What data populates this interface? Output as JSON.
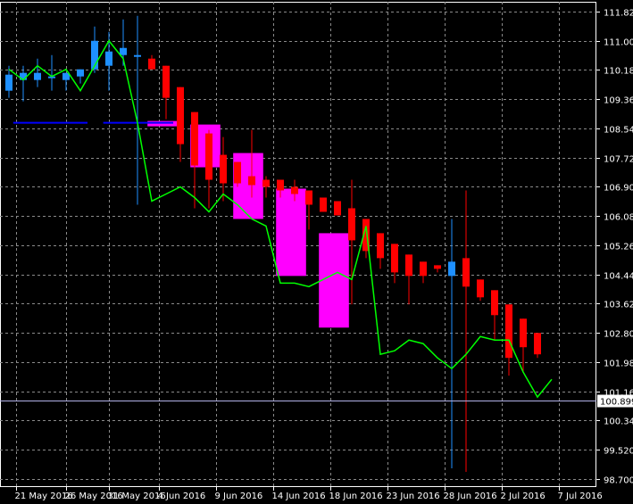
{
  "chart_data": {
    "type": "candlestick",
    "colors": {
      "background": "#000000",
      "grid": "#8a8a8a",
      "axis": "#ffffff",
      "bull": "#1e90ff",
      "bear": "#ff0000",
      "indicator_line": "#00ff00",
      "zone": "#ff00ff",
      "support": "#0000ff",
      "current_price_line": "#b0b0e6"
    },
    "y_ticks": [
      "111.820",
      "111.000",
      "110.180",
      "109.360",
      "108.540",
      "107.720",
      "106.900",
      "106.080",
      "105.260",
      "104.440",
      "103.620",
      "102.800",
      "101.980",
      "101.160",
      "100.340",
      "99.520",
      "98.700"
    ],
    "ylim": [
      98.7,
      111.82
    ],
    "x_ticks": [
      {
        "label": "21 May 2016",
        "i": 0.5
      },
      {
        "label": "26 May 2016",
        "i": 4
      },
      {
        "label": "31 May 2016",
        "i": 7
      },
      {
        "label": "4 Jun 2016",
        "i": 10.5
      },
      {
        "label": "9 Jun 2016",
        "i": 14.5
      },
      {
        "label": "14 Jun 2016",
        "i": 18.5
      },
      {
        "label": "18 Jun 2016",
        "i": 22.5
      },
      {
        "label": "23 Jun 2016",
        "i": 26.5
      },
      {
        "label": "28 Jun 2016",
        "i": 30.5
      },
      {
        "label": "2 Jul 2016",
        "i": 34.5
      },
      {
        "label": "7 Jul 2016",
        "i": 38.5
      }
    ],
    "current_price": {
      "label": "100.899",
      "value": 100.899
    },
    "candles": [
      {
        "o": 109.6,
        "h": 110.3,
        "l": 109.4,
        "c": 110.05
      },
      {
        "o": 109.9,
        "h": 110.3,
        "l": 109.3,
        "c": 110.1
      },
      {
        "o": 109.9,
        "h": 110.5,
        "l": 109.7,
        "c": 110.1
      },
      {
        "o": 110.0,
        "h": 110.6,
        "l": 109.6,
        "c": 110.0
      },
      {
        "o": 109.9,
        "h": 110.0,
        "l": 109.6,
        "c": 110.1
      },
      {
        "o": 110.0,
        "h": 110.2,
        "l": 109.8,
        "c": 110.2
      },
      {
        "o": 110.2,
        "h": 111.4,
        "l": 110.1,
        "c": 111.0
      },
      {
        "o": 110.3,
        "h": 111.25,
        "l": 109.6,
        "c": 110.7
      },
      {
        "o": 110.6,
        "h": 111.6,
        "l": 110.3,
        "c": 110.8
      },
      {
        "o": 110.55,
        "h": 111.7,
        "l": 106.4,
        "c": 110.6
      },
      {
        "o": 110.5,
        "h": 110.6,
        "l": 110.2,
        "c": 110.2
      },
      {
        "o": 110.3,
        "h": 110.3,
        "l": 108.8,
        "c": 109.4
      },
      {
        "o": 109.7,
        "h": 109.7,
        "l": 107.6,
        "c": 108.1
      },
      {
        "o": 109.0,
        "h": 109.0,
        "l": 106.3,
        "c": 107.5
      },
      {
        "o": 108.4,
        "h": 108.5,
        "l": 106.3,
        "c": 107.1
      },
      {
        "o": 107.8,
        "h": 108.3,
        "l": 106.5,
        "c": 107.0
      },
      {
        "o": 107.6,
        "h": 107.6,
        "l": 106.9,
        "c": 107.0
      },
      {
        "o": 107.2,
        "h": 108.5,
        "l": 106.6,
        "c": 106.95
      },
      {
        "o": 107.1,
        "h": 107.2,
        "l": 106.6,
        "c": 106.9
      },
      {
        "o": 107.1,
        "h": 107.1,
        "l": 106.6,
        "c": 106.8
      },
      {
        "o": 106.9,
        "h": 107.1,
        "l": 106.5,
        "c": 106.7
      },
      {
        "o": 106.8,
        "h": 106.8,
        "l": 105.7,
        "c": 106.4
      },
      {
        "o": 106.6,
        "h": 106.6,
        "l": 106.2,
        "c": 106.2
      },
      {
        "o": 106.5,
        "h": 106.5,
        "l": 106.1,
        "c": 106.1
      },
      {
        "o": 106.3,
        "h": 107.1,
        "l": 103.6,
        "c": 105.4
      },
      {
        "o": 106.0,
        "h": 106.0,
        "l": 104.9,
        "c": 105.1
      },
      {
        "o": 105.6,
        "h": 105.6,
        "l": 104.6,
        "c": 104.9
      },
      {
        "o": 105.3,
        "h": 105.3,
        "l": 104.2,
        "c": 104.5
      },
      {
        "o": 105.0,
        "h": 105.0,
        "l": 103.6,
        "c": 104.4
      },
      {
        "o": 104.8,
        "h": 104.8,
        "l": 104.2,
        "c": 104.4
      },
      {
        "o": 104.7,
        "h": 104.7,
        "l": 104.5,
        "c": 104.6
      },
      {
        "o": 104.4,
        "h": 106.0,
        "l": 99.0,
        "c": 104.8
      },
      {
        "o": 104.9,
        "h": 106.8,
        "l": 98.9,
        "c": 104.1
      },
      {
        "o": 104.3,
        "h": 104.3,
        "l": 103.7,
        "c": 103.8
      },
      {
        "o": 104.0,
        "h": 104.0,
        "l": 102.6,
        "c": 103.3
      },
      {
        "o": 103.6,
        "h": 103.6,
        "l": 101.6,
        "c": 102.1
      },
      {
        "o": 103.2,
        "h": 103.2,
        "l": 101.7,
        "c": 102.4
      },
      {
        "o": 102.8,
        "h": 102.8,
        "l": 102.1,
        "c": 102.2
      }
    ],
    "indicator_line": [
      110.2,
      109.9,
      110.3,
      110.0,
      110.2,
      109.6,
      110.3,
      111.0,
      110.5,
      108.7,
      106.5,
      106.7,
      106.9,
      106.6,
      106.2,
      106.7,
      106.4,
      106.0,
      105.8,
      104.2,
      104.2,
      104.1,
      104.3,
      104.5,
      104.3,
      105.8,
      102.2,
      102.3,
      102.6,
      102.5,
      102.1,
      101.8,
      102.2,
      102.7,
      102.6,
      102.6,
      101.7,
      101.0,
      101.5
    ],
    "zones": [
      {
        "top": 108.75,
        "bottom": 108.6,
        "i0": 19.4,
        "i1": 23.6
      },
      {
        "top": 108.65,
        "bottom": 107.45,
        "i0": 25.4,
        "i1": 29.6
      },
      {
        "top": 107.85,
        "bottom": 106.0,
        "i0": 31.4,
        "i1": 35.6
      },
      {
        "top": 106.85,
        "bottom": 104.4,
        "i0": 37.4,
        "i1": 41.6
      },
      {
        "top": 105.6,
        "bottom": 102.95,
        "i0": 43.4,
        "i1": 47.6
      }
    ],
    "support_lines": [
      {
        "value": 108.7,
        "i0": 0.3,
        "i1": 5.5
      },
      {
        "value": 108.7,
        "i0": 6.6,
        "i1": 11.5
      }
    ]
  }
}
